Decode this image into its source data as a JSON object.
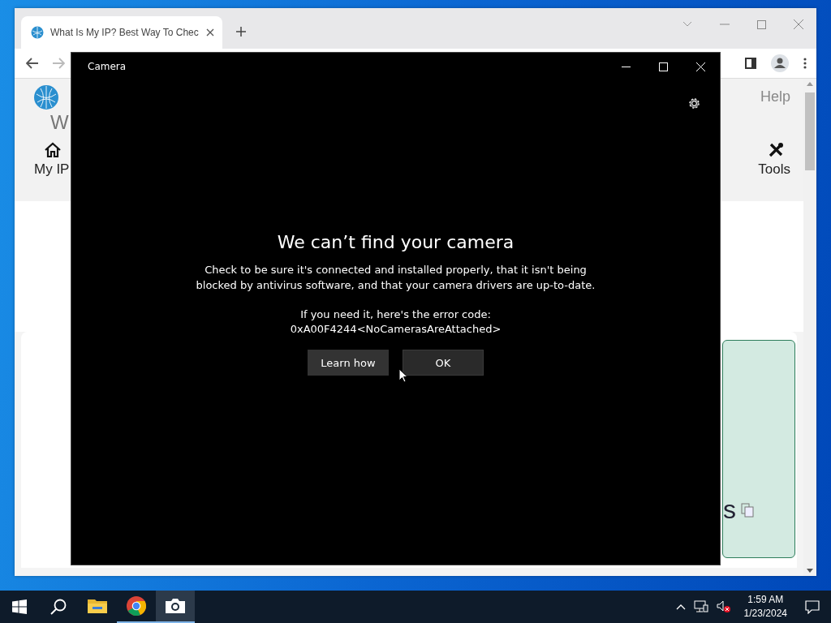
{
  "browser": {
    "tab": {
      "title": "What Is My IP? Best Way To Chec"
    },
    "page": {
      "site_title": "W",
      "help": "Help",
      "nav": [
        {
          "kind": "home",
          "caption": "My IP"
        },
        {
          "kind": "tools",
          "caption": "Tools"
        }
      ],
      "card_text": "s"
    }
  },
  "camera": {
    "title": "Camera",
    "heading": "We can’t find your camera",
    "message": "Check to be sure it's connected and installed properly, that it isn't being blocked by antivirus software, and that your camera drivers are up-to-date.",
    "error_intro": "If you need it, here's the error code:",
    "error_code": "0xA00F4244<NoCamerasAreAttached>",
    "buttons": [
      {
        "label": "Learn how",
        "kind": "secondary"
      },
      {
        "label": "OK",
        "kind": "primary"
      }
    ]
  },
  "taskbar": {
    "apps": [
      {
        "kind": "explorer",
        "running": false,
        "selected": false
      },
      {
        "kind": "chrome",
        "running": true,
        "selected": false
      },
      {
        "kind": "camera",
        "running": true,
        "selected": true
      }
    ],
    "time": "1:59 AM",
    "date": "1/23/2024"
  }
}
